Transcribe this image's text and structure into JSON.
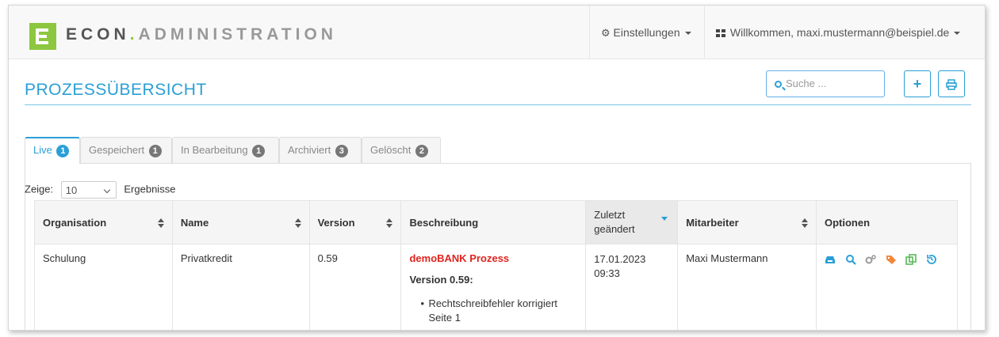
{
  "brand": {
    "part1": "ECON",
    "dot": ".",
    "part2": "ADMINISTRATION",
    "logo_letter": "E"
  },
  "nav": {
    "settings_label": "Einstellungen",
    "user_label": "Willkommen, maxi.mustermann@beispiel.de"
  },
  "page": {
    "title": "PROZESSÜBERSICHT",
    "search_placeholder": "Suche ...",
    "add_icon": "plus-icon",
    "print_icon": "print-icon"
  },
  "tabs": [
    {
      "label": "Live",
      "count": "1",
      "active": true
    },
    {
      "label": "Gespeichert",
      "count": "1"
    },
    {
      "label": "In Bearbeitung",
      "count": "1"
    },
    {
      "label": "Archiviert",
      "count": "3"
    },
    {
      "label": "Gelöscht",
      "count": "2"
    }
  ],
  "length": {
    "prefix": "Zeige:",
    "value": "10",
    "suffix": "Ergebnisse"
  },
  "table": {
    "headers": [
      "Organisation",
      "Name",
      "Version",
      "Beschreibung",
      "Zuletzt geändert",
      "Mitarbeiter",
      "Optionen"
    ],
    "rows": [
      {
        "organisation": "Schulung",
        "name": "Privatkredit",
        "version": "0.59",
        "desc_title": "demoBANK Prozess",
        "desc_version": "Version 0.59:",
        "desc_item": "Rechtschreibfehler korrigiert Seite 1",
        "date": "17.01.2023",
        "time": "09:33",
        "employee": "Maxi Mustermann"
      }
    ]
  },
  "colors": {
    "accent": "#2a9fd6",
    "brand_green": "#8dc63f",
    "highlight_red": "#e0231d"
  }
}
